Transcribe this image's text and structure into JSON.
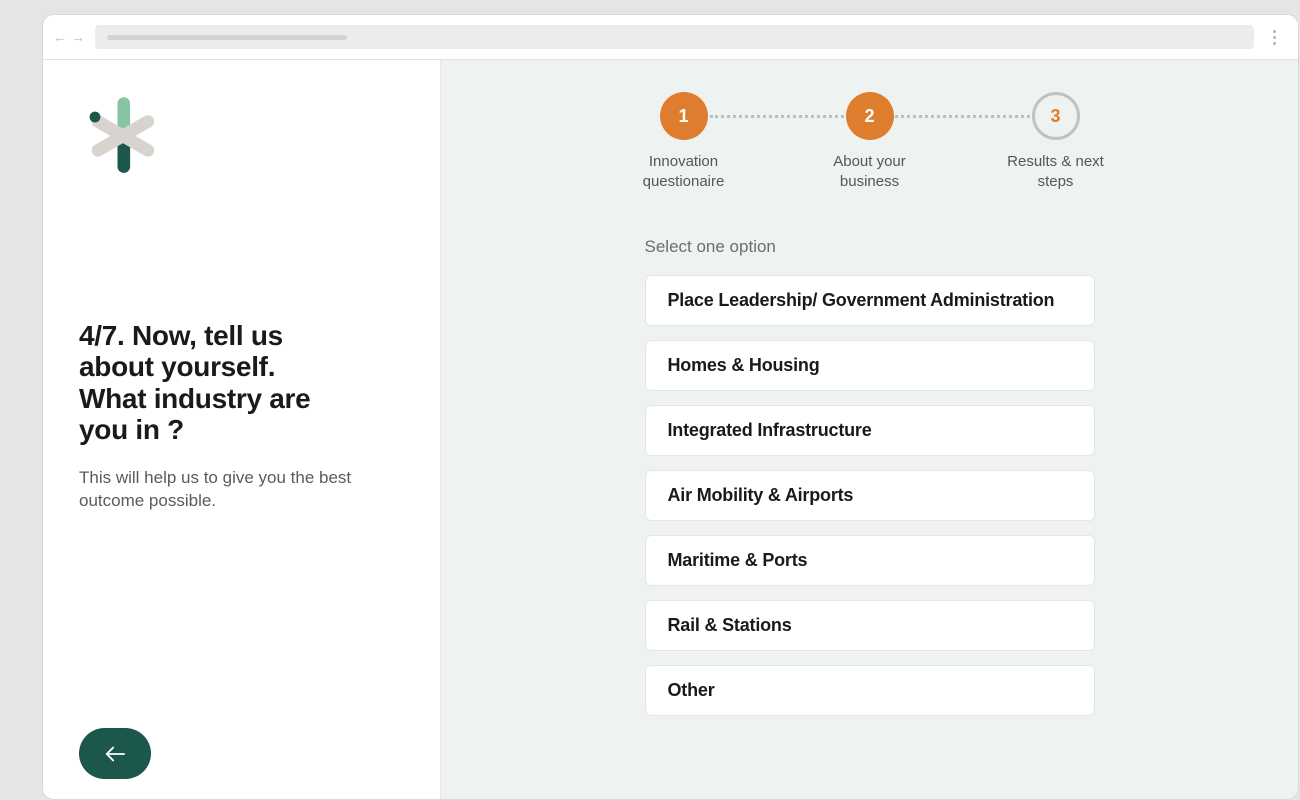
{
  "sidebar": {
    "title": "4/7. Now, tell us about yourself. What industry are you in ?",
    "subtitle": "This will help us to give you the best outcome possible."
  },
  "stepper": {
    "steps": [
      {
        "num": "1",
        "label": "Innovation questionaire",
        "state": "active"
      },
      {
        "num": "2",
        "label": "About your business",
        "state": "active"
      },
      {
        "num": "3",
        "label": "Results & next steps",
        "state": "inactive"
      }
    ]
  },
  "main": {
    "prompt": "Select one option",
    "options": [
      "Place Leadership/ Government Administration",
      "Homes & Housing",
      "Integrated Infrastructure",
      "Air Mobility & Airports",
      "Maritime & Ports",
      "Rail & Stations",
      "Other"
    ]
  }
}
